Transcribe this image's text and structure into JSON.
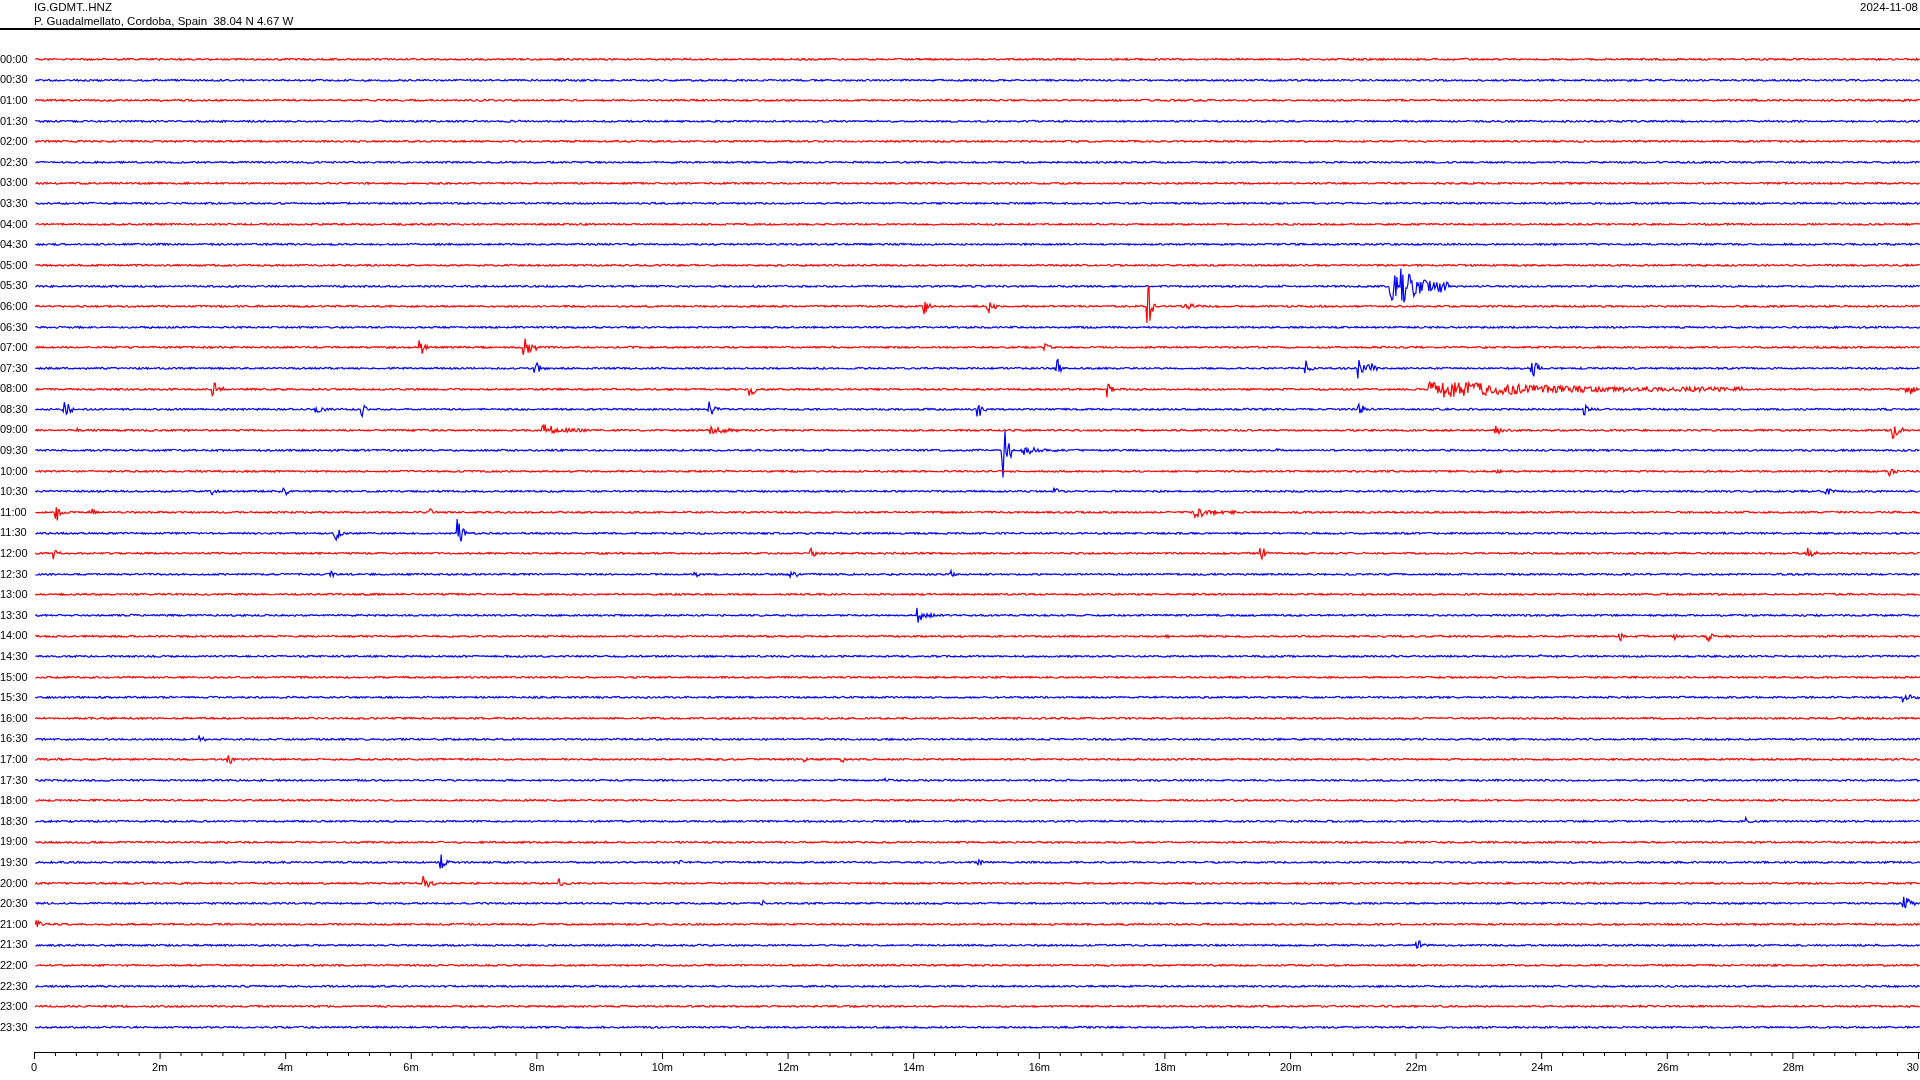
{
  "header": {
    "station": "IG.GDMT..HNZ",
    "location": "P. Guadalmellato, Cordoba, Spain  38.04 N 4.67 W",
    "date": "2024-11-08"
  },
  "traces": [
    {
      "time": "00:00",
      "color": "#ff0000"
    },
    {
      "time": "00:30",
      "color": "#0000ff"
    },
    {
      "time": "01:00",
      "color": "#ff0000"
    },
    {
      "time": "01:30",
      "color": "#0000ff"
    },
    {
      "time": "02:00",
      "color": "#ff0000"
    },
    {
      "time": "02:30",
      "color": "#0000ff"
    },
    {
      "time": "03:00",
      "color": "#ff0000"
    },
    {
      "time": "03:30",
      "color": "#0000ff"
    },
    {
      "time": "04:00",
      "color": "#ff0000"
    },
    {
      "time": "04:30",
      "color": "#0000ff"
    },
    {
      "time": "05:00",
      "color": "#ff0000"
    },
    {
      "time": "05:30",
      "color": "#0000ff"
    },
    {
      "time": "06:00",
      "color": "#ff0000"
    },
    {
      "time": "06:30",
      "color": "#0000ff"
    },
    {
      "time": "07:00",
      "color": "#ff0000"
    },
    {
      "time": "07:30",
      "color": "#0000ff"
    },
    {
      "time": "08:00",
      "color": "#ff0000"
    },
    {
      "time": "08:30",
      "color": "#0000ff"
    },
    {
      "time": "09:00",
      "color": "#ff0000"
    },
    {
      "time": "09:30",
      "color": "#0000ff"
    },
    {
      "time": "10:00",
      "color": "#ff0000"
    },
    {
      "time": "10:30",
      "color": "#0000ff"
    },
    {
      "time": "11:00",
      "color": "#ff0000"
    },
    {
      "time": "11:30",
      "color": "#0000ff"
    },
    {
      "time": "12:00",
      "color": "#ff0000"
    },
    {
      "time": "12:30",
      "color": "#0000ff"
    },
    {
      "time": "13:00",
      "color": "#ff0000"
    },
    {
      "time": "13:30",
      "color": "#0000ff"
    },
    {
      "time": "14:00",
      "color": "#ff0000"
    },
    {
      "time": "14:30",
      "color": "#0000ff"
    },
    {
      "time": "15:00",
      "color": "#ff0000"
    },
    {
      "time": "15:30",
      "color": "#0000ff"
    },
    {
      "time": "16:00",
      "color": "#ff0000"
    },
    {
      "time": "16:30",
      "color": "#0000ff"
    },
    {
      "time": "17:00",
      "color": "#ff0000"
    },
    {
      "time": "17:30",
      "color": "#0000ff"
    },
    {
      "time": "18:00",
      "color": "#ff0000"
    },
    {
      "time": "18:30",
      "color": "#0000ff"
    },
    {
      "time": "19:00",
      "color": "#ff0000"
    },
    {
      "time": "19:30",
      "color": "#0000ff"
    },
    {
      "time": "20:00",
      "color": "#ff0000"
    },
    {
      "time": "20:30",
      "color": "#0000ff"
    },
    {
      "time": "21:00",
      "color": "#ff0000"
    },
    {
      "time": "21:30",
      "color": "#0000ff"
    },
    {
      "time": "22:00",
      "color": "#ff0000"
    },
    {
      "time": "22:30",
      "color": "#0000ff"
    },
    {
      "time": "23:00",
      "color": "#ff0000"
    },
    {
      "time": "23:30",
      "color": "#0000ff"
    }
  ],
  "x_axis": {
    "tick_labels": [
      "0",
      "2m",
      "4m",
      "6m",
      "8m",
      "10m",
      "12m",
      "14m",
      "16m",
      "18m",
      "20m",
      "22m",
      "24m",
      "26m",
      "28m",
      "30"
    ]
  }
}
